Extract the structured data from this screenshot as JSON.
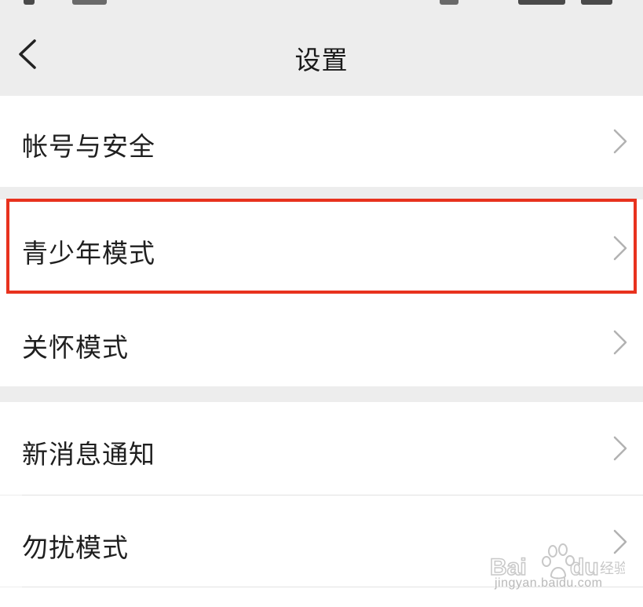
{
  "header": {
    "title": "设置",
    "back_icon": "chevron-left-icon"
  },
  "settings": {
    "items": [
      {
        "label": "帐号与安全",
        "icon": "chevron-right-icon"
      },
      {
        "label": "青少年模式",
        "icon": "chevron-right-icon",
        "highlighted": true
      },
      {
        "label": "关怀模式",
        "icon": "chevron-right-icon"
      },
      {
        "label": "新消息通知",
        "icon": "chevron-right-icon"
      },
      {
        "label": "勿扰模式",
        "icon": "chevron-right-icon"
      }
    ]
  },
  "annotation": {
    "highlight_color": "#e8321e"
  },
  "watermark": {
    "brand": "Baidu经验",
    "url": "jingyan.baidu.com"
  }
}
